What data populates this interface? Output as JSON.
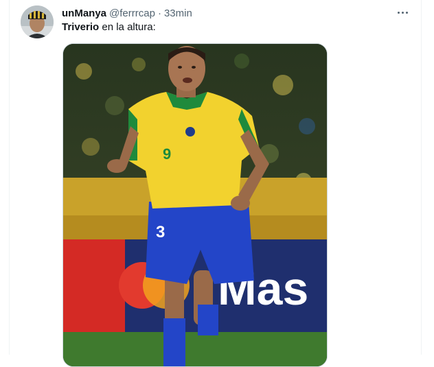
{
  "tweet": {
    "display_name": "unManya",
    "handle": "@ferrrcap",
    "separator": "·",
    "time": "33min",
    "text_mention": "Triverio",
    "text_rest": " en la altura:",
    "more_icon": "more-horizontal-icon"
  },
  "media": {
    "jersey_number": "9",
    "shorts_number": "3",
    "banner_text": "Mas"
  },
  "colors": {
    "name": "#0f1419",
    "secondary": "#536471",
    "border": "#cfd9de",
    "jersey_yellow": "#f2d22e",
    "jersey_green": "#1f8a3c",
    "shorts_blue": "#2345c8"
  }
}
